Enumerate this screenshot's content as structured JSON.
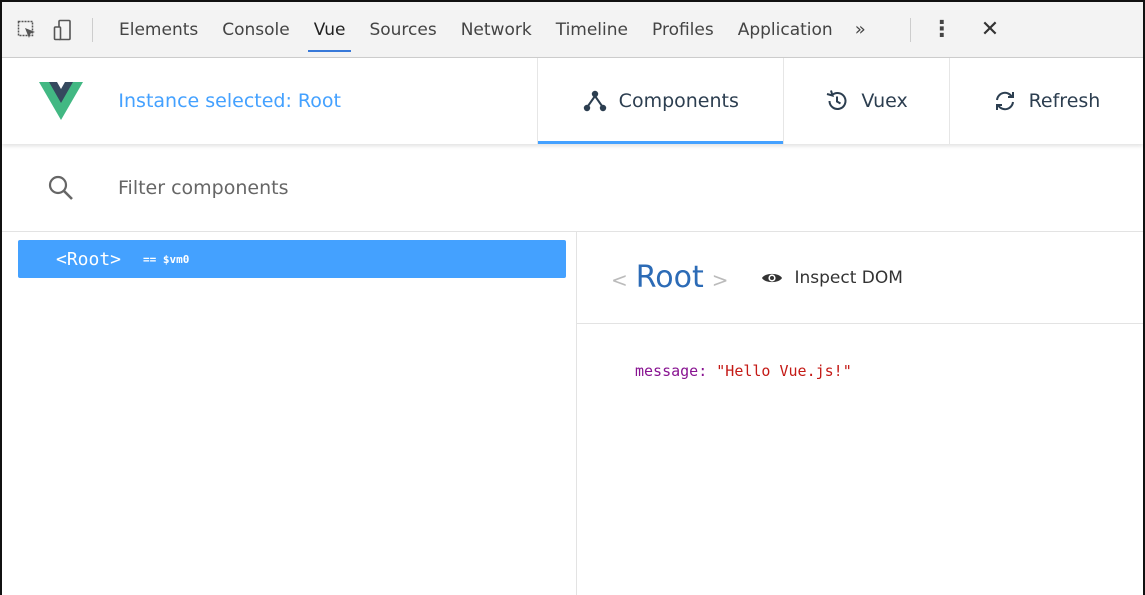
{
  "devtools": {
    "tabs": [
      {
        "label": "Elements"
      },
      {
        "label": "Console"
      },
      {
        "label": "Vue"
      },
      {
        "label": "Sources"
      },
      {
        "label": "Network"
      },
      {
        "label": "Timeline"
      },
      {
        "label": "Profiles"
      },
      {
        "label": "Application"
      }
    ],
    "active_tab": "Vue",
    "more_label": "»",
    "kebab_label": "⋮",
    "close_label": "✕"
  },
  "vue_header": {
    "instance_text": "Instance selected: Root",
    "buttons": {
      "components": "Components",
      "vuex": "Vuex",
      "refresh": "Refresh"
    },
    "accent_color": "#44a1ff",
    "logo_colors": {
      "green": "#42b883",
      "dark": "#35495e"
    }
  },
  "filter": {
    "placeholder": "Filter components"
  },
  "tree": {
    "selected": {
      "tag": "<Root>",
      "vm_label": "== $vm0"
    }
  },
  "inspector": {
    "open_bracket": "<",
    "name": "Root",
    "close_bracket": ">",
    "inspect_dom_label": "Inspect DOM",
    "property": {
      "key": "message:",
      "value": "\"Hello Vue.js!\""
    }
  }
}
